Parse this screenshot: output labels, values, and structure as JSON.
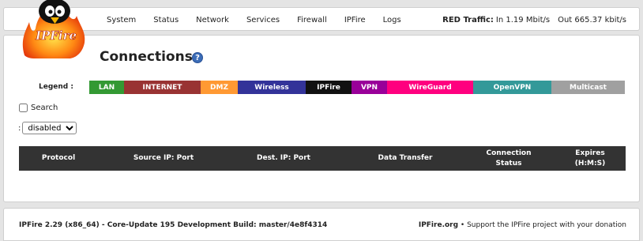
{
  "nav": {
    "items": [
      "System",
      "Status",
      "Network",
      "Services",
      "Firewall",
      "IPFire",
      "Logs"
    ]
  },
  "traffic": {
    "label": "RED Traffic:",
    "in": "In 1.19 Mbit/s",
    "out": "Out 665.37 kbit/s"
  },
  "logo": {
    "text": "IPFire"
  },
  "page": {
    "title": "Connections",
    "help_icon": "?"
  },
  "legend": {
    "label": "Legend :",
    "items": [
      {
        "label": "LAN",
        "color": "#339933"
      },
      {
        "label": "INTERNET",
        "color": "#993333"
      },
      {
        "label": "DMZ",
        "color": "#ff9933"
      },
      {
        "label": "Wireless",
        "color": "#333399"
      },
      {
        "label": "IPFire",
        "color": "#111111"
      },
      {
        "label": "VPN",
        "color": "#990099"
      },
      {
        "label": "WireGuard",
        "color": "#ff007f"
      },
      {
        "label": "OpenVPN",
        "color": "#339999"
      },
      {
        "label": "Multicast",
        "color": "#a0a0a0"
      }
    ]
  },
  "search": {
    "label": "Search",
    "checked": false
  },
  "filter": {
    "prefix": ":",
    "selected": "disabled"
  },
  "table": {
    "headers": [
      "Protocol",
      "Source IP: Port",
      "Dest. IP: Port",
      "Data Transfer",
      "Connection Status",
      "Expires (H:M:S)"
    ]
  },
  "footer": {
    "version": "IPFire 2.29 (x86_64) - Core-Update 195 Development Build: master/4e8f4314",
    "link": "IPFire.org",
    "support": "• Support the IPFire project with your donation"
  }
}
